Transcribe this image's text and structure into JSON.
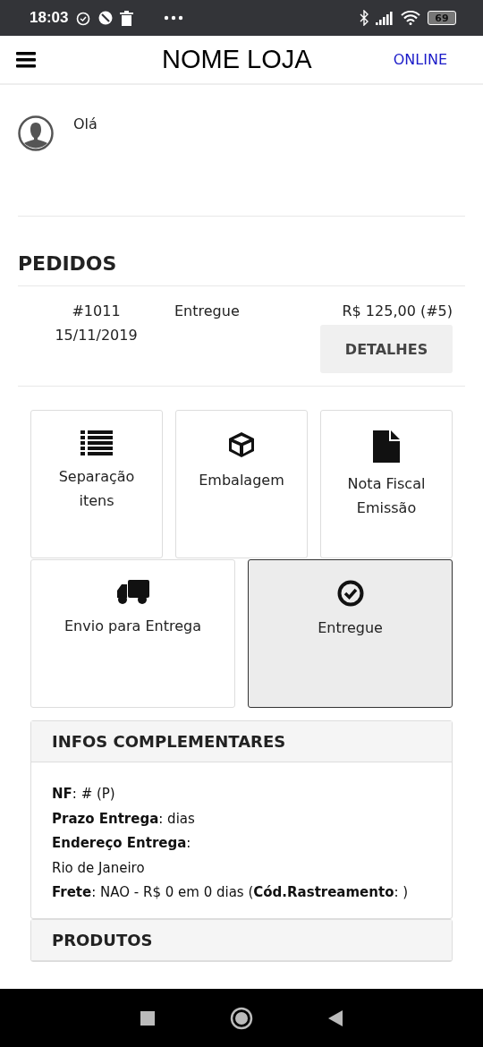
{
  "status_bar": {
    "time": "18:03",
    "battery": "69"
  },
  "header": {
    "title": "NOME LOJA",
    "status": "ONLINE"
  },
  "greeting": {
    "text": "Olá"
  },
  "orders": {
    "title": "PEDIDOS",
    "rows": [
      {
        "number": "#1011",
        "date": "15/11/2019",
        "status": "Entregue",
        "total": "R$ 125,00 (#5)",
        "button": "DETALHES"
      }
    ]
  },
  "steps": [
    {
      "label": "Separação itens",
      "selected": false
    },
    {
      "label": "Embalagem",
      "selected": false
    },
    {
      "label": "Nota Fiscal Emissão",
      "selected": false
    },
    {
      "label": "Envio para Entrega",
      "selected": false
    },
    {
      "label": "Entregue",
      "selected": true
    }
  ],
  "info": {
    "title": "INFOS COMPLEMENTARES",
    "lines": [
      "**NF**: # (P)",
      "**Prazo Entrega**: dias",
      "**Endereço Entrega**:",
      "Rio de Janeiro",
      "**Frete**: NAO - R$ 0 em 0 dias (**Cód.Rastreamento**: )"
    ]
  },
  "products": {
    "title": "PRODUTOS"
  }
}
